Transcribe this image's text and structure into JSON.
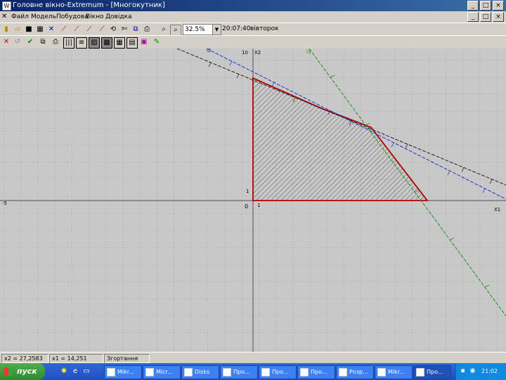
{
  "window": {
    "title": "Головне вікно-Extremum - [Многокутник]",
    "app_icon_label": "W",
    "buttons": {
      "minimize": "_",
      "maximize": "□",
      "close": "×"
    }
  },
  "menu": {
    "items": [
      "Файл",
      "Модель",
      "Побудова",
      "Вікно",
      "Довідка"
    ]
  },
  "toolbar": {
    "zoom_value": "32.5%",
    "clock": "20:07:40",
    "day": "вівторок"
  },
  "graph": {
    "axis_labels": {
      "x": "X1",
      "y": "X2",
      "origin": "0",
      "x_left": "-5",
      "y_top": "10",
      "tick_y": "1",
      "tick_x": "1",
      "line1": "l2",
      "line2": "l3"
    },
    "colors": {
      "background": "#c8c8c8",
      "grid": "#8e8e8e",
      "axis": "#505050",
      "polygon_stroke": "#b00000",
      "line_black": "#202020",
      "line_blue": "#2030d0",
      "line_green": "#1f8f1f"
    }
  },
  "status": {
    "x2": "x2 = 27,2583",
    "x1": "x1 = 14,251",
    "state": "Згортання"
  },
  "taskbar": {
    "start_label": "пуск",
    "tasks": [
      "Mikr...",
      "Micr...",
      "Disks",
      "Про...",
      "Про...",
      "Про...",
      "Розр...",
      "Mikr...",
      "Про..."
    ],
    "tray_time": "21:02"
  }
}
